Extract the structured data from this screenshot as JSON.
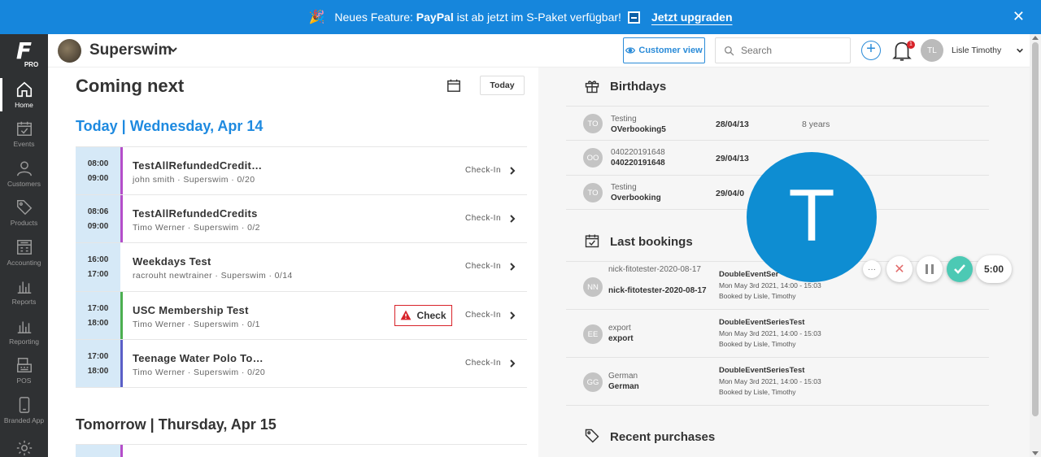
{
  "banner": {
    "prefix": "Neues Feature: ",
    "highlight": "PayPal",
    "suffix": " ist ab jetzt im S-Paket verfügbar!",
    "cta": "Jetzt upgraden",
    "close": "✕",
    "party_icon": "🎉"
  },
  "sidebar": {
    "logo_letter": "F",
    "logo_sub": "PRO",
    "items": [
      {
        "label": "Home",
        "icon": "home-icon"
      },
      {
        "label": "Events",
        "icon": "calendar-check-icon"
      },
      {
        "label": "Customers",
        "icon": "user-icon"
      },
      {
        "label": "Products",
        "icon": "tag-icon"
      },
      {
        "label": "Accounting",
        "icon": "calculator-icon"
      },
      {
        "label": "Reports",
        "icon": "bar-chart-icon"
      },
      {
        "label": "Reporting",
        "icon": "bar-chart-icon"
      },
      {
        "label": "POS",
        "icon": "register-icon"
      },
      {
        "label": "Branded App",
        "icon": "phone-icon"
      },
      {
        "label": "",
        "icon": "gear-icon"
      }
    ]
  },
  "topbar": {
    "brand": "Superswim",
    "customer_view": "Customer view",
    "search_placeholder": "Search",
    "notif_count": "1",
    "user_initials": "TL",
    "user_name": "Lisle Timothy"
  },
  "left": {
    "title": "Coming next",
    "today_btn": "Today",
    "today_heading": "Today | Wednesday, Apr 14",
    "tomorrow_heading": "Tomorrow | Thursday, Apr 15",
    "events": [
      {
        "start": "08:00",
        "end": "09:00",
        "title": "TestAllRefundedCredit…",
        "sub": "john smith · Superswim · 0/20",
        "action": "Check-In",
        "color": "#b44ec9"
      },
      {
        "start": "08:06",
        "end": "09:00",
        "title": "TestAllRefundedCredits",
        "sub": "Timo Werner · Superswim · 0/2",
        "action": "Check-In",
        "color": "#b44ec9"
      },
      {
        "start": "16:00",
        "end": "17:00",
        "title": "Weekdays Test",
        "sub": "racrouht newtrainer · Superswim · 0/14",
        "action": "Check-In",
        "color": "#ffffff"
      },
      {
        "start": "17:00",
        "end": "18:00",
        "title": "USC Membership Test",
        "sub": "Timo Werner · Superswim · 0/1",
        "action": "Check-In",
        "color": "#4caf50",
        "warning": "Check"
      },
      {
        "start": "17:00",
        "end": "18:00",
        "title": "Teenage Water Polo To…",
        "sub": "Timo Werner · Superswim · 0/20",
        "action": "Check-In",
        "color": "#5b5fc7"
      }
    ]
  },
  "right": {
    "birthdays_title": "Birthdays",
    "birthdays": [
      {
        "initials": "TO",
        "line1": "Testing",
        "line2": "OVerbooking5",
        "date": "28/04/13",
        "age": "8 years"
      },
      {
        "initials": "OO",
        "line1": "040220191648",
        "line2": "040220191648",
        "date": "29/04/13",
        "age": ""
      },
      {
        "initials": "TO",
        "line1": "Testing",
        "line2": "Overbooking",
        "date": "29/04/0",
        "age": ""
      }
    ],
    "last_bookings_title": "Last bookings",
    "bookings": [
      {
        "initials": "NN",
        "line1": "nick-fitotester-2020-08-17",
        "line2": "nick-fitotester-2020-08-17",
        "event": "DoubleEventSer",
        "time": "Mon May 3rd 2021, 14:00 - 15:03",
        "by": "Booked by Lisle, Timothy"
      },
      {
        "initials": "EE",
        "line1": "export",
        "line2": "export",
        "event": "DoubleEventSeriesTest",
        "time": "Mon May 3rd 2021, 14:00 - 15:03",
        "by": "Booked by Lisle, Timothy"
      },
      {
        "initials": "GG",
        "line1": "German",
        "line2": "German",
        "event": "DoubleEventSeriesTest",
        "time": "Mon May 3rd 2021, 14:00 - 15:03",
        "by": "Booked by Lisle, Timothy"
      }
    ],
    "recent_purchases_title": "Recent purchases"
  },
  "overlay": {
    "letter": "T",
    "more": "···",
    "cancel": "✕",
    "timer": "5:00",
    "color": "#0e8dd2"
  }
}
